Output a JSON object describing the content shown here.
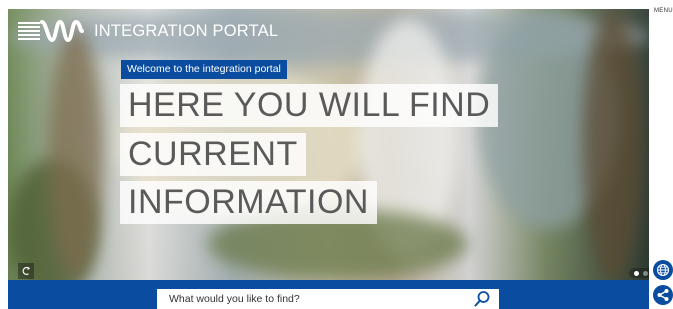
{
  "header": {
    "logo_text": "INTEGRATION PORTAL",
    "menu_label": "MENU"
  },
  "hero": {
    "welcome": "Welcome to the integration portal",
    "headline": [
      "HERE YOU WILL FIND",
      "CURRENT",
      "INFORMATION"
    ],
    "slider": {
      "total_slides": 2,
      "active_slide": 1
    }
  },
  "search": {
    "placeholder": "What would you like to find?"
  },
  "icons": {
    "logo": "brand-wave-logo",
    "pause": "pause-icon",
    "globe": "globe-icon",
    "share": "share-icon",
    "search": "search-icon"
  },
  "colors": {
    "brand_blue": "#0a4da0",
    "headline_text": "#5a5a5a",
    "white": "#ffffff"
  }
}
